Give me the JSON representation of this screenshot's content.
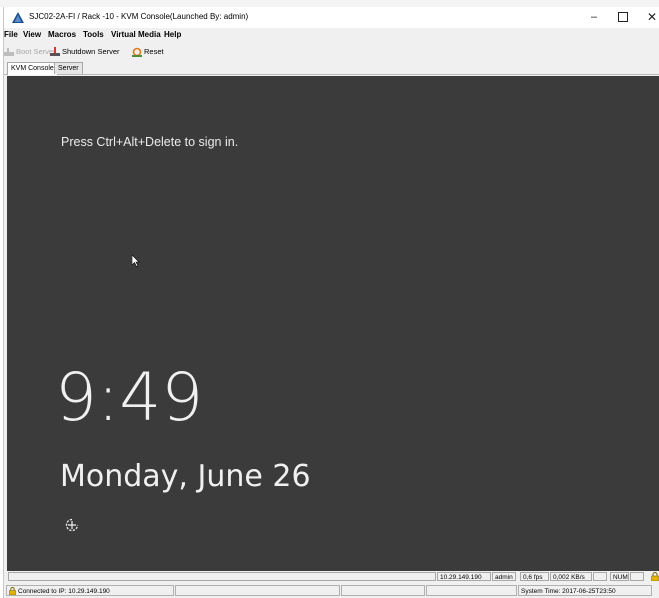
{
  "window": {
    "title": "SJC02-2A-FI / Rack -10 - KVM Console(Launched By: admin)",
    "minimize_label": "–",
    "close_label": "✕"
  },
  "menubar": {
    "items": [
      "File",
      "View",
      "Macros",
      "Tools",
      "Virtual Media",
      "Help"
    ]
  },
  "toolbar": {
    "boot_label": "Boot Server",
    "shutdown_label": "Shutdown Server",
    "reset_label": "Reset"
  },
  "tabs": [
    {
      "label": "KVM Console",
      "active": true
    },
    {
      "label": "Server",
      "active": false
    }
  ],
  "screen": {
    "prompt": "Press Ctrl+Alt+Delete to sign in.",
    "time": "9:49",
    "date": "Monday, June 26"
  },
  "status": {
    "ip": "10.29.149.190",
    "user": "admin",
    "fps": "0,6 fps",
    "rate": "0,002 KB/s",
    "num": "NUM"
  },
  "footer": {
    "connected": "Connected to IP: 10.29.149.190",
    "system_time": "System Time: 2017-06-25T23:50"
  },
  "colors": {
    "screen_bg": "#3b3b3b",
    "screen_text": "#f0f0f0",
    "disabled_text": "#a8a8a8",
    "shutdown_icon": "#d23c1e",
    "reset_icon": "#e07a1a",
    "lock_icon": "#e2b400"
  },
  "icons": {
    "app": "cisco-triangle-icon",
    "boot": "power-on-icon",
    "shutdown": "power-off-icon",
    "reset": "reset-icon",
    "lock": "lock-icon",
    "cursor": "mouse-pointer-icon",
    "accessibility": "ease-of-access-icon"
  }
}
